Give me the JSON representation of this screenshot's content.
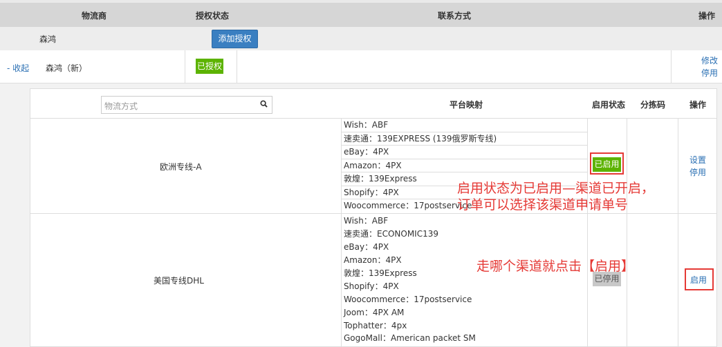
{
  "header": {
    "col_logistics": "物流商",
    "col_auth_status": "授权状态",
    "col_contact": "联系方式",
    "col_action": "操作"
  },
  "provider_row": {
    "name": "森鸿",
    "add_auth_label": "添加授权"
  },
  "auth_row": {
    "collapse_label": "- 收起",
    "name": "森鸿（新）",
    "status_badge": "已授权",
    "edit_label": "修改",
    "disable_label": "停用"
  },
  "channel_table": {
    "search_placeholder": "物流方式",
    "col_platform_mapping": "平台映射",
    "col_enable_status": "启用状态",
    "col_sort_code": "分拣码",
    "col_action": "操作",
    "rows": [
      {
        "name": "欧洲专线-A",
        "mappings": [
          "Wish：ABF",
          "速卖通：139EXPRESS (139俄罗斯专线)",
          "eBay：4PX",
          "Amazon：4PX",
          "敦煌：139Express",
          "Shopify：4PX",
          "Woocommerce：17postservice"
        ],
        "status": "已启用",
        "action_settings": "设置",
        "action_disable": "停用"
      },
      {
        "name": "美国专线DHL",
        "mappings": [
          "Wish：ABF",
          "速卖通：ECONOMIC139",
          "eBay：4PX",
          "Amazon：4PX",
          "敦煌：139Express",
          "Shopify：4PX",
          "Woocommerce：17postservice",
          "Joom：4PX AM",
          "Tophatter：4px",
          "GogoMall：American packet SM"
        ],
        "status": "已停用",
        "action_enable": "启用"
      }
    ]
  },
  "annotations": {
    "enabled_note_line1": "启用状态为已启用—渠道已开启，",
    "enabled_note_line2": "订单可以选择该渠道申请单号",
    "enable_hint": "走哪个渠道就点击【启用】"
  },
  "colors": {
    "accent_blue": "#3a7fc1",
    "enabled_green": "#5cb300",
    "annotation_red": "#e53935"
  }
}
